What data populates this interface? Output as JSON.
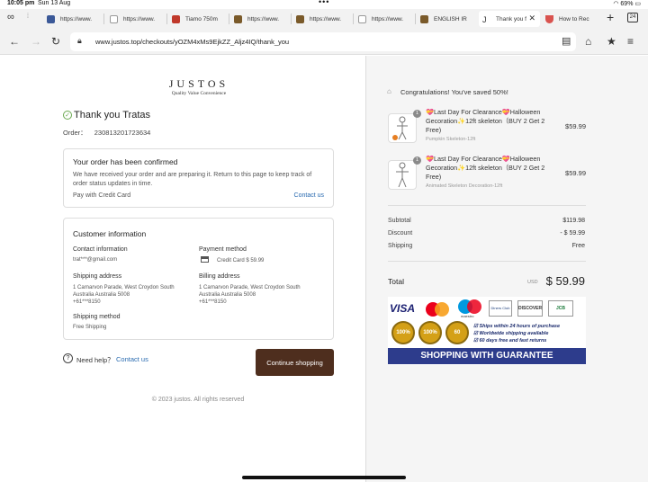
{
  "status": {
    "time": "10:05 pm",
    "date": "Sun 13 Aug",
    "battery": "69%",
    "tab_count": "24"
  },
  "tabs": [
    {
      "label": "https://www.",
      "icon": "facebook-icon"
    },
    {
      "label": "https://www.",
      "icon": "google-icon"
    },
    {
      "label": "Tiamo 750m",
      "icon": "store-icon"
    },
    {
      "label": "https://www.",
      "icon": "bank-icon"
    },
    {
      "label": "https://www.",
      "icon": "bank-icon"
    },
    {
      "label": "https://www.",
      "icon": "google-icon"
    },
    {
      "label": "ENGLISH IR",
      "icon": "bank-icon"
    },
    {
      "label": "Thank you f",
      "icon": "justos-icon"
    },
    {
      "label": "How to Rec",
      "icon": "shield-icon"
    }
  ],
  "url": "www.justos.top/checkouts/yOZM4xMs9EjkZZ_Aljz4IQ/thank_you",
  "logo": {
    "name": "JUSTOS",
    "tagline": "Quality Value Convenience"
  },
  "thank_you": "Thank you Tratas",
  "order": {
    "label": "Order：",
    "number": "230813201723634"
  },
  "confirm": {
    "title": "Your order has been confirmed",
    "body": "We have received your order and are preparing it. Return to this page to keep track of order status updates in time.",
    "pay": "Pay with Credit Card",
    "contact": "Contact us"
  },
  "customer": {
    "title": "Customer information",
    "contact_label": "Contact information",
    "contact_value": "trat***@gmail.com",
    "payment_label": "Payment method",
    "payment_value": "Credit Card $ 59.99",
    "shipping_label": "Shipping address",
    "shipping_lines": [
      "1 Carnarvon Parade, West Croydon South",
      "Australia Australia 5008",
      "+61***8150"
    ],
    "billing_label": "Billing address",
    "billing_lines": [
      "1 Carnarvon Parade, West Croydon South",
      "Australia Australia 5008",
      "+61***8150"
    ],
    "method_label": "Shipping method",
    "method_value": "Free Shipping"
  },
  "help": {
    "label": "Need help？",
    "link": "Contact us"
  },
  "continue": "Continue shopping",
  "footer": "© 2023 justos. All rights reserved",
  "savings": "Congratulations! You've saved 50%!",
  "products": [
    {
      "title": "💝Last Day For Clearance💝Halloween Gecoration✨12ft skeleton（BUY 2 Get 2 Free)",
      "variant": "Pumpkin Skeleton-12ft",
      "price": "$59.99",
      "qty": "1"
    },
    {
      "title": "💝Last Day For Clearance💝Halloween Gecoration✨12ft skeleton（BUY 2 Get 2 Free)",
      "variant": "Animated Skeleton Decoration-12ft",
      "price": "$59.99",
      "qty": "1"
    }
  ],
  "summary": {
    "subtotal_label": "Subtotal",
    "subtotal": "$119.98",
    "discount_label": "Discount",
    "discount": "- $ 59.99",
    "shipping_label": "Shipping",
    "shipping": "Free",
    "total_label": "Total",
    "currency": "USD",
    "total": "$ 59.99"
  },
  "badges": {
    "cards": [
      "VISA",
      "mastercard",
      "maestro",
      "Diners Club",
      "DISCOVER",
      "JCB"
    ],
    "seals": [
      "100%",
      "100%",
      "60"
    ],
    "bullets": [
      "Ships within 24 hours of purchase",
      "Worldwide shipping available",
      "60 days free and fast returns"
    ],
    "banner": "SHOPPING WITH GUARANTEE"
  },
  "colors": {
    "brown": "#4e2e1e",
    "link": "#2a6bb0",
    "banner": "#2d3c8c"
  }
}
